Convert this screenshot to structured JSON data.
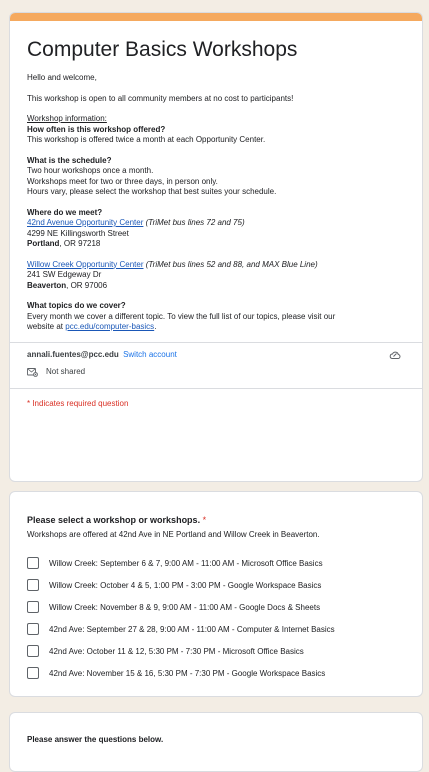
{
  "intro": {
    "title": "Computer Basics Workshops",
    "greeting": "Hello and welcome,",
    "open_note": "This workshop is open to all community members at no cost to participants!",
    "info_heading": "Workshop information:",
    "q1": "How often is this workshop offered?",
    "a1": "This workshop is offered twice a month at each Opportunity Center.",
    "q2": "What is the schedule?",
    "a2_lines": [
      "Two hour workshops once a month.",
      "Workshops meet for two or three days, in person only.",
      "Hours vary, please select the workshop that best suites your schedule."
    ],
    "q3": "Where do we meet?",
    "loc1_name": "42nd Avenue Opportunity Center",
    "loc1_note": " (TriMet bus lines 72 and 75)",
    "loc1_street": "4299 NE Killingsworth Street",
    "loc1_city": "Portland",
    "loc1_state": ", OR 97218",
    "loc2_name": "Willow Creek Opportunity Center",
    "loc2_note": " (TriMet bus lines 52 and 88, and MAX Blue Line)",
    "loc2_street": "241 SW Edgeway Dr",
    "loc2_city": "Beaverton",
    "loc2_state": ", OR 97006",
    "q4": "What topics do we cover?",
    "a4_line1": "Every month we cover a different topic. To view the full list of our topics, please visit our",
    "a4_prefix": "website at ",
    "a4_link": "pcc.edu/computer-basics",
    "a4_suffix": "."
  },
  "account": {
    "email": "annali.fuentes@pcc.edu",
    "switch_label": "Switch account",
    "not_shared": "Not shared",
    "required_note": "* Indicates required question"
  },
  "question": {
    "title": "Please select a workshop or workshops.",
    "star": " *",
    "subtitle": "Workshops are offered at 42nd Ave in NE Portland and Willow Creek in Beaverton.",
    "options": [
      "Willow Creek: September 6 & 7, 9:00 AM - 11:00 AM - Microsoft Office Basics",
      "Willow Creek: October 4 & 5, 1:00 PM - 3:00 PM - Google Workspace Basics",
      "Willow Creek: November 8 & 9, 9:00 AM - 11:00 AM - Google Docs & Sheets",
      "42nd Ave: September 27 & 28, 9:00 AM - 11:00 AM - Computer & Internet Basics",
      "42nd Ave: October 11 & 12, 5:30 PM - 7:30 PM - Microsoft Office Basics",
      "42nd Ave: November 15 & 16, 5:30 PM - 7:30 PM - Google Workspace Basics"
    ]
  },
  "next_section": {
    "title": "Please answer the questions below."
  },
  "colors": {
    "accent": "#f5a95e",
    "link": "#1a57b7",
    "required": "#d93025",
    "background": "#f3ede4"
  }
}
